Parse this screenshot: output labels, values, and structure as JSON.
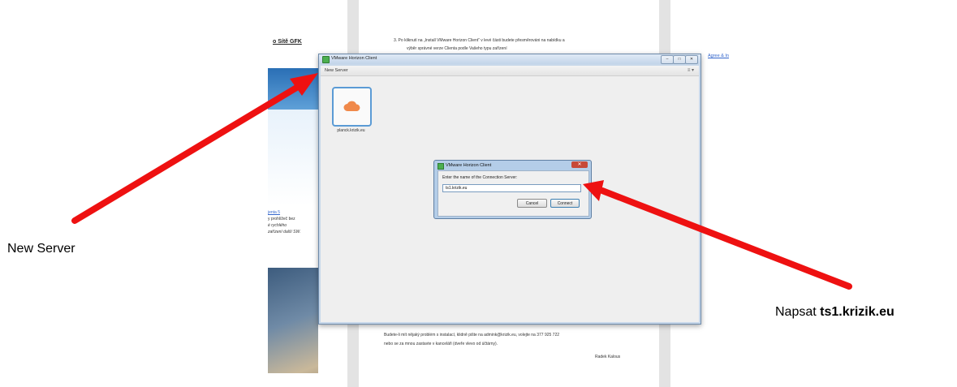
{
  "background_doc": {
    "left_title": "o Sítě GFK",
    "left_lines": [
      "jenta 5",
      "y prohlížeč bez",
      "é rychlého",
      "zařízení další SW."
    ],
    "step_line1": "3.   Po kliknutí na „Install VMware Horizon Client“ v levé části budete přesměrováni na nabídku a",
    "step_line2": "výběr  správné verze Clienta podle Vašeho typu zařízení",
    "agree": "Agree & In",
    "footer_line1": "Budete-li mít nějaký problém s instalací, klidně pište na admink@krizik.eu,  volejte na 377 925 722",
    "footer_line2": "nebo se za mnou zastavte v kanceláři (dveře vlevo od účtárny).",
    "signature": "Radek Kalous"
  },
  "window": {
    "title": "VMware Horizon Client",
    "minimize": "–",
    "maximize": "□",
    "close": "✕",
    "toolbar_new_server": "New Server",
    "toolbar_menu_icon": "≡ ▾"
  },
  "server": {
    "icon": "cloud-icon",
    "label": "planck.krizik.eu"
  },
  "dialog": {
    "title": "VMware Horizon Client",
    "close": "✕",
    "prompt": "Enter the name of the Connection Server:",
    "input_value": "ts1.krizik.eu",
    "cancel_label": "Cancel",
    "connect_label": "Connect"
  },
  "annotations": {
    "left": "New Server",
    "right_prefix": "Napsat ",
    "right_bold": "ts1.krizik.eu",
    "arrow_color": "#ee1111"
  }
}
